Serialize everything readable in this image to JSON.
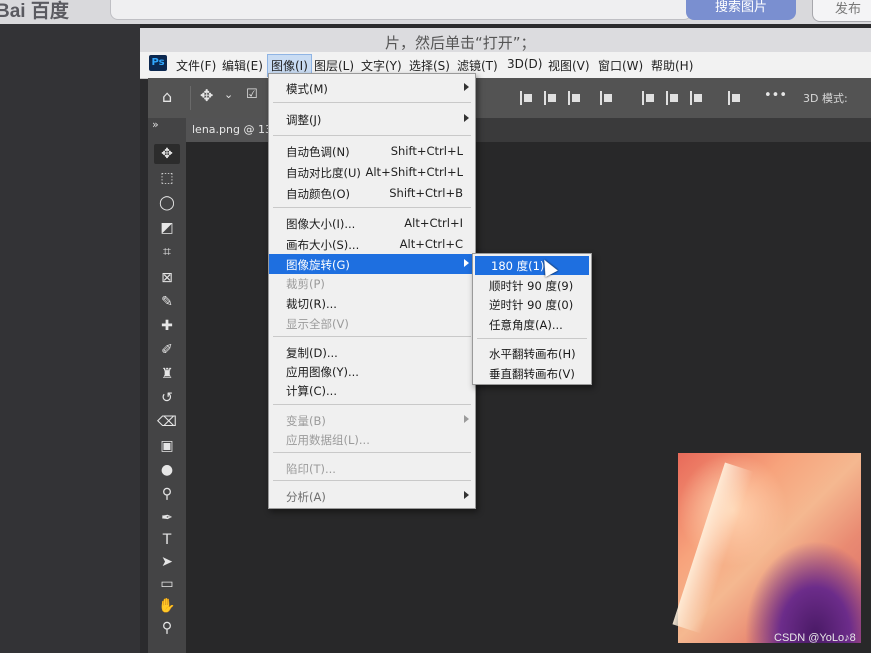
{
  "browser": {
    "logo": "Bai 百度",
    "search_button": "搜索图片",
    "secondary_button": "发布"
  },
  "caption": "片，然后单击“打开”；",
  "menubar": {
    "logo": "Ps",
    "items": [
      "文件(F)",
      "编辑(E)",
      "图像(I)",
      "图层(L)",
      "文字(Y)",
      "选择(S)",
      "滤镜(T)",
      "3D(D)",
      "视图(V)",
      "窗口(W)",
      "帮助(H)"
    ],
    "active_index": 2
  },
  "options_bar": {
    "mode_label": "3D 模式:",
    "more": "•••"
  },
  "document": {
    "tab_title": "lena.png @ 13"
  },
  "image_menu": {
    "items": [
      {
        "label": "模式(M)",
        "shortcut": "",
        "submenu": true,
        "disabled": false
      },
      {
        "label": "调整(J)",
        "shortcut": "",
        "submenu": true,
        "disabled": false
      },
      {
        "label": "自动色调(N)",
        "shortcut": "Shift+Ctrl+L",
        "submenu": false,
        "disabled": false
      },
      {
        "label": "自动对比度(U)",
        "shortcut": "Alt+Shift+Ctrl+L",
        "submenu": false,
        "disabled": false
      },
      {
        "label": "自动颜色(O)",
        "shortcut": "Shift+Ctrl+B",
        "submenu": false,
        "disabled": false
      },
      {
        "label": "图像大小(I)...",
        "shortcut": "Alt+Ctrl+I",
        "submenu": false,
        "disabled": false
      },
      {
        "label": "画布大小(S)...",
        "shortcut": "Alt+Ctrl+C",
        "submenu": false,
        "disabled": false
      },
      {
        "label": "图像旋转(G)",
        "shortcut": "",
        "submenu": true,
        "disabled": false,
        "highlighted": true
      },
      {
        "label": "裁剪(P)",
        "shortcut": "",
        "submenu": false,
        "disabled": true
      },
      {
        "label": "裁切(R)...",
        "shortcut": "",
        "submenu": false,
        "disabled": false
      },
      {
        "label": "显示全部(V)",
        "shortcut": "",
        "submenu": false,
        "disabled": true
      },
      {
        "label": "复制(D)...",
        "shortcut": "",
        "submenu": false,
        "disabled": false
      },
      {
        "label": "应用图像(Y)...",
        "shortcut": "",
        "submenu": false,
        "disabled": false
      },
      {
        "label": "计算(C)...",
        "shortcut": "",
        "submenu": false,
        "disabled": false
      },
      {
        "label": "变量(B)",
        "shortcut": "",
        "submenu": true,
        "disabled": true
      },
      {
        "label": "应用数据组(L)...",
        "shortcut": "",
        "submenu": false,
        "disabled": true
      },
      {
        "label": "陷印(T)...",
        "shortcut": "",
        "submenu": false,
        "disabled": true
      },
      {
        "label": "分析(A)",
        "shortcut": "",
        "submenu": true,
        "disabled": true
      }
    ]
  },
  "rotate_submenu": {
    "items": [
      {
        "label": "180 度(1)",
        "highlighted": true
      },
      {
        "label": "顺时针 90 度(9)",
        "highlighted": false
      },
      {
        "label": "逆时针 90 度(0)",
        "highlighted": false
      },
      {
        "label": "任意角度(A)...",
        "highlighted": false
      },
      {
        "label": "水平翻转画布(H)",
        "highlighted": false
      },
      {
        "label": "垂直翻转画布(V)",
        "highlighted": false
      }
    ]
  },
  "watermark": "CSDN @YoLo♪8",
  "colors": {
    "menu_highlight": "#1e6fe0",
    "menu_bg": "#f0f0f0",
    "workspace": "#282829",
    "panel": "#444445"
  }
}
